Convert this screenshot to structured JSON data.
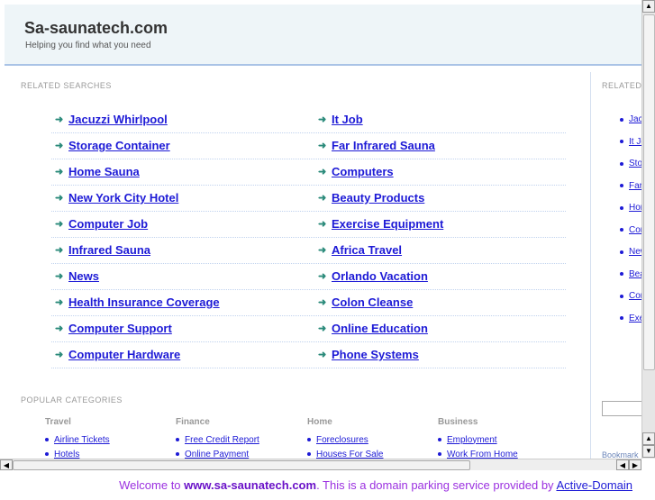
{
  "header": {
    "title": "Sa-saunatech.com",
    "tagline": "Helping you find what you need"
  },
  "related": {
    "label": "RELATED SEARCHES",
    "left": [
      "Jacuzzi Whirlpool",
      "Storage Container",
      "Home Sauna",
      "New York City Hotel",
      "Computer Job",
      "Infrared Sauna",
      "News",
      "Health Insurance Coverage",
      "Computer Support",
      "Computer Hardware"
    ],
    "right": [
      "It Job",
      "Far Infrared Sauna",
      "Computers",
      "Beauty Products",
      "Exercise Equipment",
      "Africa Travel",
      "Orlando Vacation",
      "Colon Cleanse",
      "Online Education",
      "Phone Systems"
    ]
  },
  "sidebar": {
    "label": "RELATED SEARCHES",
    "items": [
      "Jacuzzi Whirlpool",
      "It Job",
      "Storage Container",
      "Far Infrared Sauna",
      "Home Sauna",
      "Computers",
      "New York City Hotel",
      "Beauty Products",
      "Computer Job",
      "Exercise Equipment"
    ],
    "bookmark": "Bookmark"
  },
  "popular": {
    "label": "POPULAR CATEGORIES",
    "columns": [
      {
        "title": "Travel",
        "items": [
          "Airline Tickets",
          "Hotels"
        ]
      },
      {
        "title": "Finance",
        "items": [
          "Free Credit Report",
          "Online Payment"
        ]
      },
      {
        "title": "Home",
        "items": [
          "Foreclosures",
          "Houses For Sale"
        ]
      },
      {
        "title": "Business",
        "items": [
          "Employment",
          "Work From Home"
        ]
      }
    ]
  },
  "footer": {
    "pre": "Welcome to ",
    "domain": "www.sa-saunatech.com",
    "mid": ". This is a domain parking service provided by ",
    "link": "Active-Domain"
  }
}
